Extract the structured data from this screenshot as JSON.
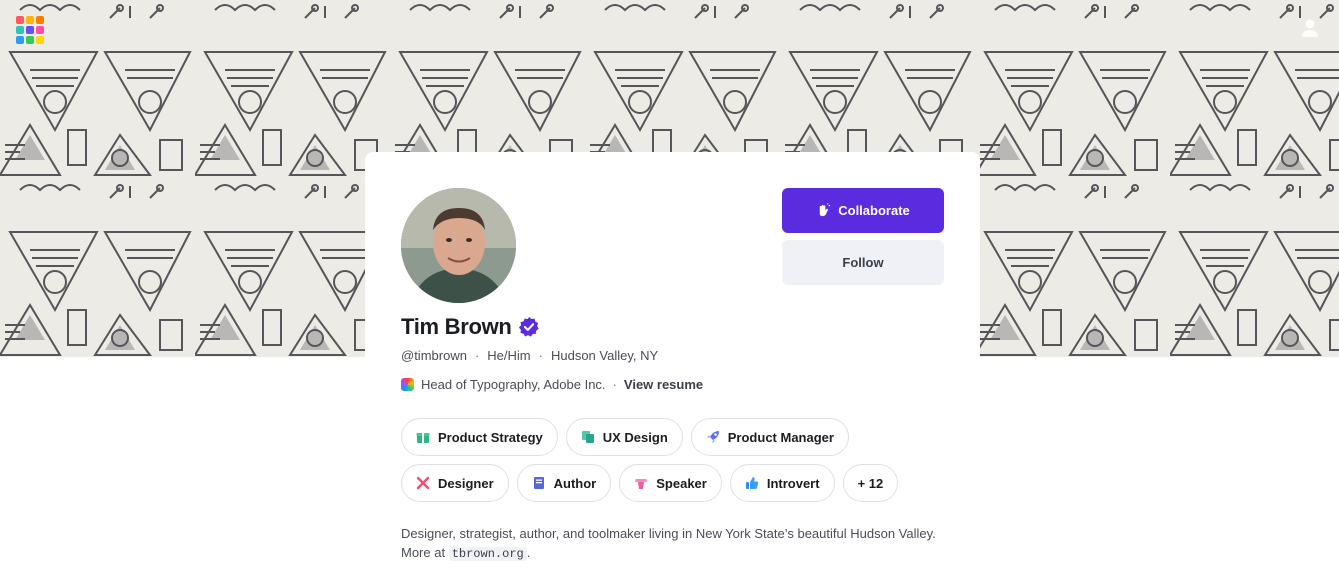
{
  "banner": {
    "pattern": "hand-drawn geometric triangles and circles",
    "bg_color": "#ecebe5",
    "line_color": "#55555a"
  },
  "app": {
    "logo_icon": "app-grid-logo",
    "account_icon": "user-icon"
  },
  "profile": {
    "name": "Tim Brown",
    "verified_icon": "verified-badge-icon",
    "handle": "@timbrown",
    "pronouns": "He/Him",
    "location": "Hudson Valley, NY",
    "separator": "·",
    "job_title": "Head of Typography, Adobe Inc.",
    "resume_link": "View resume"
  },
  "actions": {
    "collaborate_label": "Collaborate",
    "follow_label": "Follow",
    "accent_color": "#5b2be0"
  },
  "tags": [
    {
      "label": "Product Strategy",
      "icon": "gift-icon"
    },
    {
      "label": "UX Design",
      "icon": "copy-icon"
    },
    {
      "label": "Product Manager",
      "icon": "rocket-icon"
    },
    {
      "label": "Designer",
      "icon": "tools-icon"
    },
    {
      "label": "Author",
      "icon": "book-icon"
    },
    {
      "label": "Speaker",
      "icon": "podium-icon"
    },
    {
      "label": "Introvert",
      "icon": "thumbs-up-icon"
    },
    {
      "label": "+ 12",
      "icon": ""
    }
  ],
  "bio": {
    "text": "Designer, strategist, author, and toolmaker living in New York State’s beautiful Hudson Valley.",
    "more_prefix": "More at",
    "link_text": "tbrown.org",
    "suffix": "."
  }
}
